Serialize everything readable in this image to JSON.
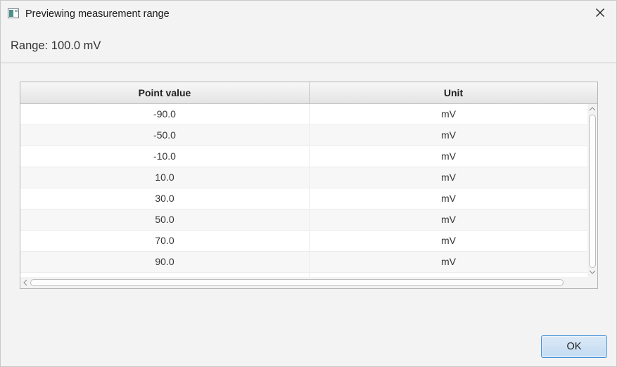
{
  "window": {
    "title": "Previewing measurement range",
    "icon": "app-window-icon",
    "close_icon": "close-icon"
  },
  "header": {
    "range_label": "Range: 100.0 mV"
  },
  "table": {
    "columns": [
      "Point value",
      "Unit"
    ],
    "rows": [
      [
        "-90.0",
        "mV"
      ],
      [
        "-50.0",
        "mV"
      ],
      [
        "-10.0",
        "mV"
      ],
      [
        "10.0",
        "mV"
      ],
      [
        "30.0",
        "mV"
      ],
      [
        "50.0",
        "mV"
      ],
      [
        "70.0",
        "mV"
      ],
      [
        "90.0",
        "mV"
      ]
    ]
  },
  "footer": {
    "ok_label": "OK"
  },
  "colors": {
    "accent_border": "#3f8fd6",
    "ok_background": "#c3dbf2"
  }
}
